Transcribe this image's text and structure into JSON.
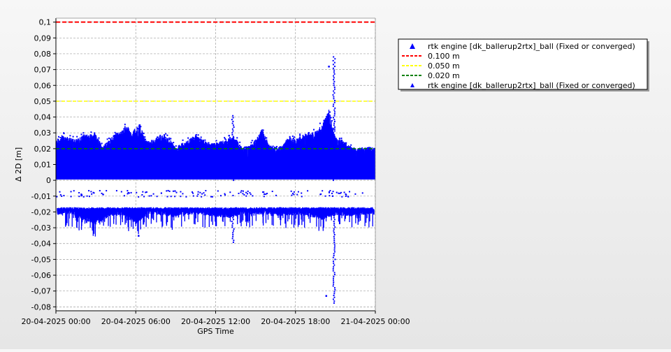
{
  "chart_data": {
    "type": "scatter",
    "title": "",
    "xlabel": "GPS Time",
    "ylabel": "Δ 2D [m]",
    "xlim": [
      "20-04-2025 00:00",
      "21-04-2025 00:00"
    ],
    "ylim": [
      -0.08,
      0.1
    ],
    "x_ticks": [
      "20-04-2025 00:00",
      "20-04-2025 06:00",
      "20-04-2025 12:00",
      "20-04-2025 18:00",
      "21-04-2025 00:00"
    ],
    "y_ticks": [
      "-0,08",
      "-0,07",
      "-0,06",
      "-0,05",
      "-0,04",
      "-0,03",
      "-0,02",
      "-0,01",
      "0",
      "0,01",
      "0,02",
      "0,03",
      "0,04",
      "0,05",
      "0,06",
      "0,07",
      "0,08",
      "0,09",
      "0,1"
    ],
    "y_tick_values": [
      -0.08,
      -0.07,
      -0.06,
      -0.05,
      -0.04,
      -0.03,
      -0.02,
      -0.01,
      0,
      0.01,
      0.02,
      0.03,
      0.04,
      0.05,
      0.06,
      0.07,
      0.08,
      0.09,
      0.1
    ],
    "grid": true,
    "legend_position": "top-right, outside plot",
    "colors": {
      "series": "#0000ff",
      "line_0100": "#ff0000",
      "line_0050": "#ffff00",
      "line_0020": "#008000"
    },
    "reference_lines": [
      {
        "name": "0.100 m",
        "y": 0.1,
        "color": "#ff0000",
        "style": "dashed"
      },
      {
        "name": "0.050 m",
        "y": 0.05,
        "color": "#ffff00",
        "style": "dashed"
      },
      {
        "name": "0.020 m",
        "y": 0.02,
        "color": "#008000",
        "style": "dashed"
      }
    ],
    "legend": [
      {
        "label": "rtk engine [dk_ballerup2rtx]_ball (Fixed or converged)",
        "symbol": "triangle-large"
      },
      {
        "label": "0.100 m",
        "symbol": "dash-red"
      },
      {
        "label": "0.050 m",
        "symbol": "dash-yellow"
      },
      {
        "label": "0.020 m",
        "symbol": "dash-green"
      },
      {
        "label": "rtk engine [dk_ballerup2rtx]_ball (Fixed or converged)",
        "symbol": "triangle-small"
      }
    ],
    "series": [
      {
        "name": "rtk engine [dk_ballerup2rtx]_ball (Fixed or converged)",
        "description_of_envelope": "x in hours since 20-04-2025 00:00",
        "upper_envelope": [
          [
            0.0,
            0.025
          ],
          [
            0.5,
            0.029
          ],
          [
            1.0,
            0.027
          ],
          [
            1.5,
            0.026
          ],
          [
            2.0,
            0.029
          ],
          [
            2.5,
            0.03
          ],
          [
            3.0,
            0.029
          ],
          [
            3.5,
            0.022
          ],
          [
            4.0,
            0.026
          ],
          [
            4.5,
            0.03
          ],
          [
            5.0,
            0.032
          ],
          [
            5.3,
            0.036
          ],
          [
            5.7,
            0.03
          ],
          [
            6.0,
            0.034
          ],
          [
            6.3,
            0.036
          ],
          [
            6.7,
            0.026
          ],
          [
            7.0,
            0.025
          ],
          [
            7.5,
            0.027
          ],
          [
            8.0,
            0.029
          ],
          [
            8.5,
            0.027
          ],
          [
            9.0,
            0.021
          ],
          [
            9.5,
            0.024
          ],
          [
            10.0,
            0.026
          ],
          [
            10.5,
            0.029
          ],
          [
            11.0,
            0.026
          ],
          [
            11.5,
            0.023
          ],
          [
            12.0,
            0.024
          ],
          [
            12.5,
            0.025
          ],
          [
            13.0,
            0.027
          ],
          [
            13.5,
            0.027
          ],
          [
            14.0,
            0.021
          ],
          [
            14.5,
            0.022
          ],
          [
            15.0,
            0.026
          ],
          [
            15.5,
            0.033
          ],
          [
            16.0,
            0.023
          ],
          [
            16.5,
            0.02
          ],
          [
            17.0,
            0.022
          ],
          [
            17.5,
            0.028
          ],
          [
            18.0,
            0.026
          ],
          [
            18.5,
            0.029
          ],
          [
            19.0,
            0.03
          ],
          [
            19.5,
            0.031
          ],
          [
            20.0,
            0.036
          ],
          [
            20.5,
            0.045
          ],
          [
            21.0,
            0.028
          ],
          [
            21.5,
            0.026
          ],
          [
            22.0,
            0.022
          ],
          [
            22.5,
            0.02
          ],
          [
            23.0,
            0.021
          ],
          [
            24.0,
            0.021
          ]
        ],
        "lower_band": [
          [
            0.0,
            -0.018
          ],
          [
            1.0,
            -0.017
          ],
          [
            2.0,
            -0.021
          ],
          [
            3.0,
            -0.024
          ],
          [
            4.0,
            -0.019
          ],
          [
            5.0,
            -0.018
          ],
          [
            6.0,
            -0.024
          ],
          [
            7.0,
            -0.017
          ],
          [
            8.0,
            -0.018
          ],
          [
            9.0,
            -0.02
          ],
          [
            10.0,
            -0.017
          ],
          [
            11.0,
            -0.018
          ],
          [
            12.0,
            -0.019
          ],
          [
            13.0,
            -0.02
          ],
          [
            14.0,
            -0.017
          ],
          [
            15.0,
            -0.018
          ],
          [
            16.0,
            -0.017
          ],
          [
            17.0,
            -0.019
          ],
          [
            18.0,
            -0.018
          ],
          [
            19.0,
            -0.019
          ],
          [
            20.0,
            -0.021
          ],
          [
            21.0,
            -0.018
          ],
          [
            22.0,
            -0.019
          ],
          [
            23.0,
            -0.018
          ],
          [
            24.0,
            -0.017
          ]
        ],
        "outlier_spikes": [
          {
            "x": 20.9,
            "y_max": 0.079,
            "y_min": -0.078
          },
          {
            "x": 20.5,
            "y": 0.072
          },
          {
            "x": 20.3,
            "y": -0.073
          },
          {
            "x": 13.3,
            "y_max": 0.041,
            "y_min": -0.04
          },
          {
            "x": 6.2,
            "y": -0.035
          }
        ]
      }
    ]
  }
}
